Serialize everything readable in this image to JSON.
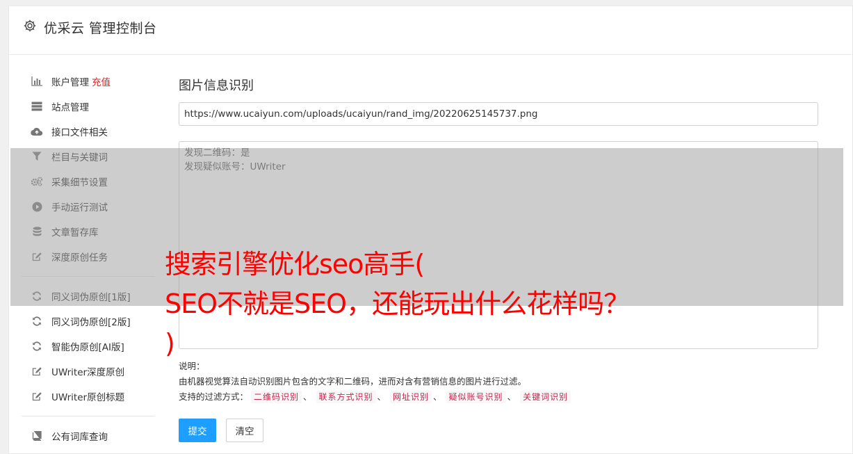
{
  "header": {
    "title": "优采云 管理控制台",
    "icon": "gear-icon"
  },
  "sidebar": {
    "group1": [
      {
        "label": "账户管理",
        "tag": "充值",
        "icon": "bar-chart-icon"
      },
      {
        "label": "站点管理",
        "icon": "server-icon"
      },
      {
        "label": "接口文件相关",
        "icon": "cloud-upload-icon"
      },
      {
        "label": "栏目与关键词",
        "icon": "filter-icon"
      },
      {
        "label": "采集细节设置",
        "icon": "cogs-icon"
      },
      {
        "label": "手动运行测试",
        "icon": "play-circle-icon"
      },
      {
        "label": "文章暂存库",
        "icon": "database-icon"
      },
      {
        "label": "深度原创任务",
        "icon": "edit-icon"
      }
    ],
    "group2": [
      {
        "label": "同义词伪原创[1版]",
        "icon": "refresh-icon"
      },
      {
        "label": "同义词伪原创[2版]",
        "icon": "refresh-icon"
      },
      {
        "label": "智能伪原创[AI版]",
        "icon": "refresh-icon"
      },
      {
        "label": "UWriter深度原创",
        "icon": "edit-icon"
      },
      {
        "label": "UWriter原创标题",
        "icon": "edit-icon"
      }
    ],
    "group3": [
      {
        "label": "公有词库查询",
        "icon": "book-icon"
      }
    ]
  },
  "main": {
    "title": "图片信息识别",
    "url_value": "https://www.ucaiyun.com/uploads/ucaiyun/rand_img/20220625145737.png",
    "result_text": "发现二维码：是\n发现疑似账号：UWriter",
    "notes": {
      "label": "说明：",
      "description": "由机器视觉算法自动识别图片包含的文字和二维码，进而对含有营销信息的图片进行过滤。",
      "filter_label": "支持的过滤方式：",
      "filters": [
        "二维码识别",
        "联系方式识别",
        "网址识别",
        "疑似账号识别",
        "关键词识别"
      ],
      "separator": "、"
    },
    "submit_label": "提交",
    "clear_label": "清空"
  },
  "overlay": {
    "lines": [
      "搜索引擎优化seo高手(",
      "SEO不就是SEO，还能玩出什么花样吗？",
      ")"
    ]
  },
  "colors": {
    "accent": "#1e9fff",
    "danger": "#e02020",
    "chip_text": "#c7254e",
    "overlay_text": "#ff0000"
  }
}
